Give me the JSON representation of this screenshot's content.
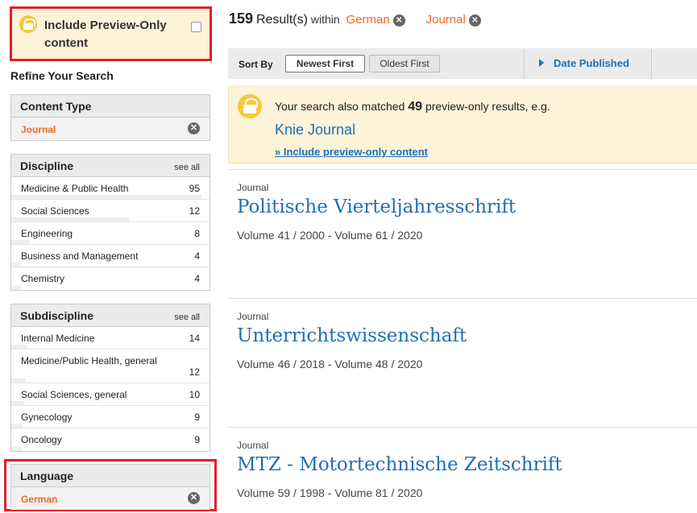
{
  "preview_toggle": {
    "label": "Include Preview-Only content",
    "icon": "lock-icon",
    "checked": false
  },
  "sidebar": {
    "refine_title": "Refine Your Search",
    "content_type": {
      "title": "Content Type",
      "selected": "Journal"
    },
    "discipline": {
      "title": "Discipline",
      "see_all": "see all",
      "items": [
        {
          "label": "Medicine & Public Health",
          "count": "95"
        },
        {
          "label": "Social Sciences",
          "count": "12"
        },
        {
          "label": "Engineering",
          "count": "8"
        },
        {
          "label": "Business and Management",
          "count": "4"
        },
        {
          "label": "Chemistry",
          "count": "4"
        }
      ]
    },
    "subdiscipline": {
      "title": "Subdiscipline",
      "see_all": "see all",
      "items": [
        {
          "label": "Internal Medicine",
          "count": "14"
        },
        {
          "label": "Medicine/Public Health, general",
          "count": "12"
        },
        {
          "label": "Social Sciences, general",
          "count": "10"
        },
        {
          "label": "Gynecology",
          "count": "9"
        },
        {
          "label": "Oncology",
          "count": "9"
        }
      ]
    },
    "language": {
      "title": "Language",
      "selected": "German"
    }
  },
  "results_header": {
    "count": "159",
    "result_word": "Result(s)",
    "within": "within",
    "filters": [
      "German",
      "Journal"
    ]
  },
  "sortbar": {
    "label": "Sort By",
    "newest": "Newest First",
    "oldest": "Oldest First",
    "date_published": "Date Published"
  },
  "notice": {
    "text_before": "Your search also matched",
    "count": "49",
    "text_after": "preview-only results, e.g.",
    "example": "Knie Journal",
    "link": "» Include preview-only content"
  },
  "results": [
    {
      "type": "Journal",
      "title": "Politische Vierteljahresschrift",
      "volumes": "Volume 41 / 2000 - Volume 61 / 2020"
    },
    {
      "type": "Journal",
      "title": "Unterrichtswissenschaft",
      "volumes": "Volume 46 / 2018 - Volume 48 / 2020"
    },
    {
      "type": "Journal",
      "title": "MTZ - Motortechnische Zeitschrift",
      "volumes": "Volume 59 / 1998 - Volume 81 / 2020"
    }
  ],
  "colors": {
    "accent_orange": "#f16722",
    "link_blue": "#1f6fb5",
    "highlight_red": "#e81c24",
    "notice_bg": "#fcf3d8"
  }
}
